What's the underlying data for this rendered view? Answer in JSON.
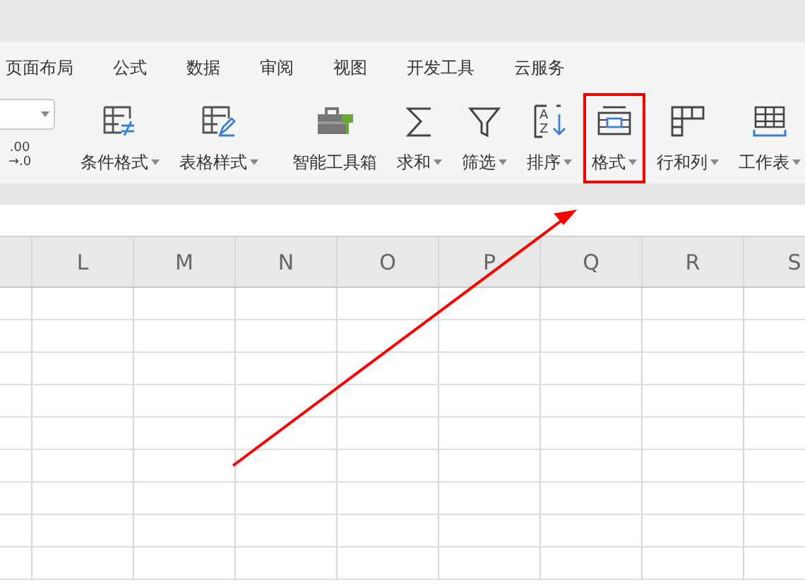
{
  "tabs": [
    {
      "label": "页面布局",
      "selected": false
    },
    {
      "label": "公式",
      "selected": false
    },
    {
      "label": "数据",
      "selected": false
    },
    {
      "label": "审阅",
      "selected": false
    },
    {
      "label": "视图",
      "selected": false
    },
    {
      "label": "开发工具",
      "selected": false
    },
    {
      "label": "云服务",
      "selected": false
    }
  ],
  "decimal_buttons": [
    {
      "top": ".00",
      "bottom": "→.0"
    }
  ],
  "ribbon_groups": [
    [
      {
        "label": "条件格式",
        "kind": "conditional",
        "highlighted": false
      },
      {
        "label": "表格样式",
        "kind": "tablestyle",
        "highlighted": false
      }
    ],
    [
      {
        "label": "智能工具箱",
        "kind": "toolbox",
        "highlighted": false,
        "dropdown": false
      },
      {
        "label": "求和",
        "kind": "sum",
        "highlighted": false
      },
      {
        "label": "筛选",
        "kind": "filter",
        "highlighted": false
      },
      {
        "label": "排序",
        "kind": "sort",
        "icon_letters": [
          "A",
          "Z"
        ],
        "highlighted": false
      },
      {
        "label": "格式",
        "kind": "format",
        "highlighted": true
      },
      {
        "label": "行和列",
        "kind": "rowcol",
        "highlighted": false
      },
      {
        "label": "工作表",
        "kind": "sheet",
        "highlighted": false
      }
    ]
  ],
  "columns": [
    "L",
    "M",
    "N",
    "O",
    "P",
    "Q",
    "R",
    "S"
  ]
}
